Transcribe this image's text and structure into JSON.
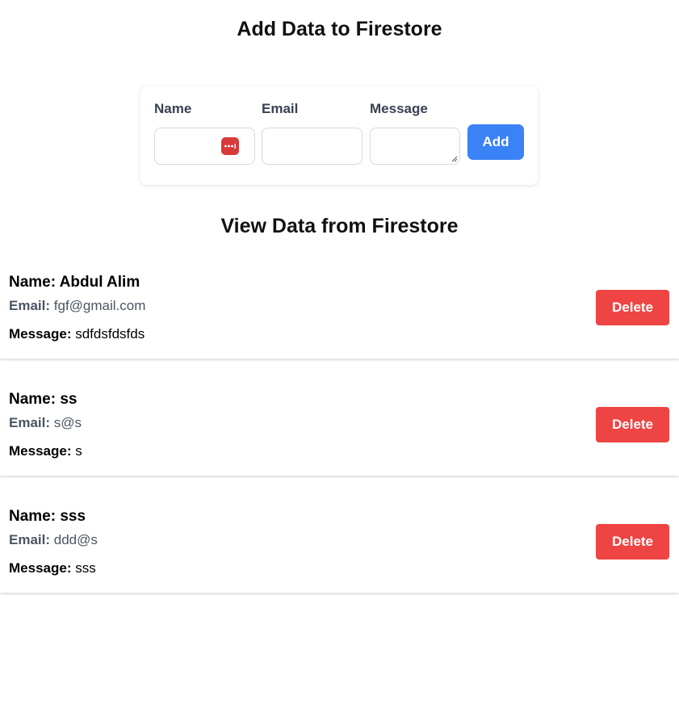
{
  "header": {
    "title": "Add Data to Firestore"
  },
  "form": {
    "name_label": "Name",
    "email_label": "Email",
    "message_label": "Message",
    "name_value": "",
    "email_value": "",
    "message_value": "",
    "add_label": "Add",
    "password_manager_icon": "password-manager-icon",
    "accent_color": "#3b82f6"
  },
  "list": {
    "title": "View Data from Firestore",
    "name_key": "Name:",
    "email_key": "Email:",
    "message_key": "Message:",
    "delete_label": "Delete",
    "delete_color": "#ef4444",
    "records": [
      {
        "name": "Abdul Alim",
        "email": "fgf@gmail.com",
        "message": "sdfdsfdsfds"
      },
      {
        "name": "ss",
        "email": "s@s",
        "message": "s"
      },
      {
        "name": "sss",
        "email": "ddd@s",
        "message": "sss"
      }
    ]
  }
}
